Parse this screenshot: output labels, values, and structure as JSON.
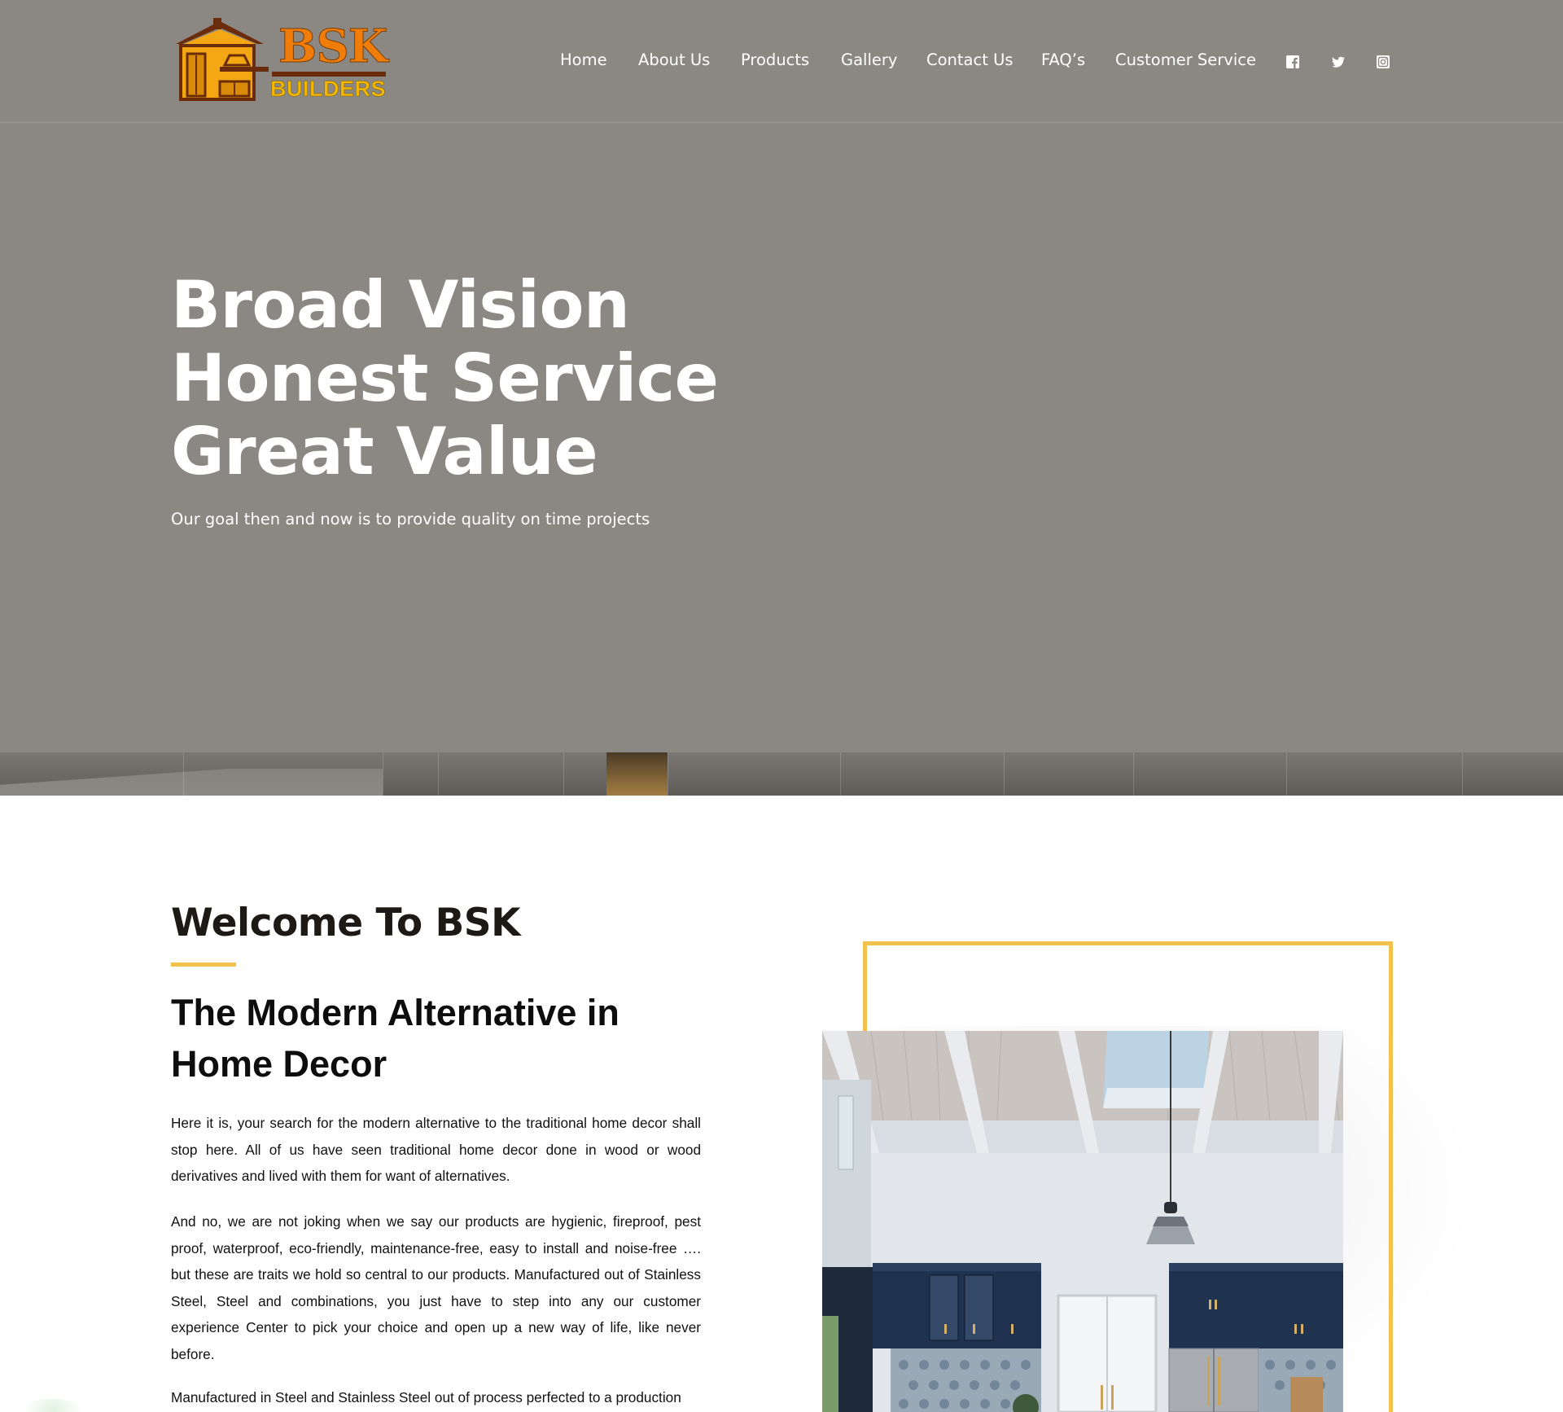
{
  "brand": {
    "name": "BSK",
    "tagline": "BUILDERS",
    "colors": {
      "orange": "#f07d0a",
      "gold": "#f5b800",
      "accent": "#f2c14e",
      "hero_bg": "#8b8883"
    }
  },
  "nav": {
    "items": [
      {
        "label": "Home"
      },
      {
        "label": "About Us"
      },
      {
        "label": "Products"
      },
      {
        "label": "Gallery"
      },
      {
        "label": "Contact Us"
      },
      {
        "label": "FAQ’s"
      },
      {
        "label": "Customer Service"
      }
    ],
    "social": [
      {
        "icon": "facebook-icon"
      },
      {
        "icon": "twitter-icon"
      },
      {
        "icon": "instagram-icon"
      }
    ]
  },
  "hero": {
    "title_lines": [
      "Broad Vision",
      "Honest Service",
      "Great Value"
    ],
    "subtitle": "Our goal then and now is to provide quality on time projects"
  },
  "welcome": {
    "title": "Welcome To BSK",
    "subhead": "The Modern Alternative in Home Decor",
    "paragraphs": [
      "Here it is, your search for the modern alternative to the traditional home decor shall stop here. All of us have seen traditional home decor done in wood or wood derivatives and lived with them for want of alternatives.",
      "And no, we are not joking when we say our products are hygienic, fireproof, pest proof, waterproof, eco-friendly, maintenance-free, easy to install and noise-free …. but these are traits we hold so central to our products. Manufactured out of Stainless Steel, Steel and combinations, you just have to step into any our customer experience Center to pick your choice and open up a new way of life, like never before.",
      "Manufactured in Steel and Stainless Steel out of process perfected to a production"
    ]
  }
}
